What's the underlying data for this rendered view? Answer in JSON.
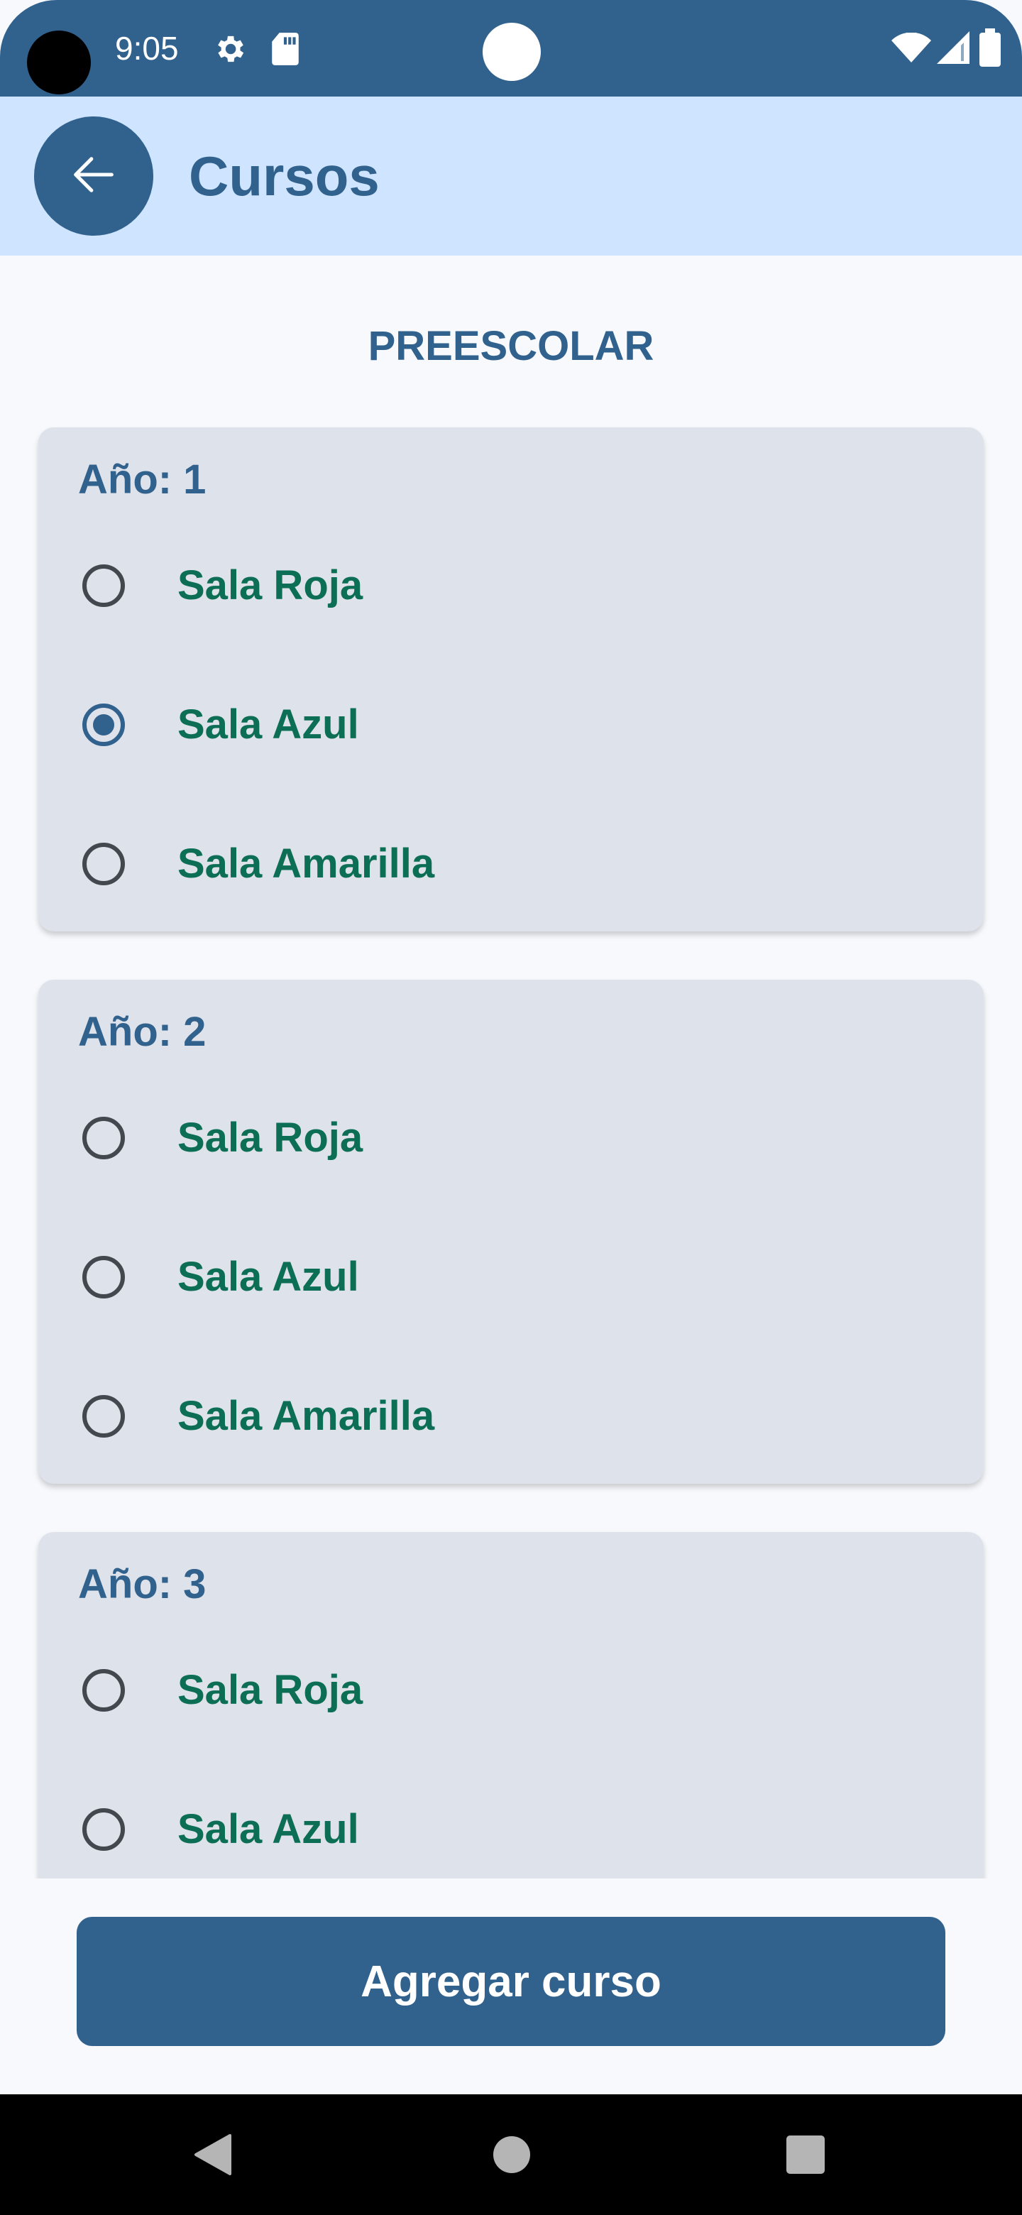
{
  "status_bar": {
    "time": "9:05",
    "icons": [
      "gear-icon",
      "sd-card-icon",
      "wifi-icon",
      "signal-icon",
      "battery-icon"
    ]
  },
  "app_bar": {
    "title": "Cursos",
    "back_icon": "arrow-back-icon"
  },
  "section": {
    "title": "PREESCOLAR"
  },
  "years": [
    {
      "title": "Año: 1",
      "options": [
        {
          "label": "Sala Roja",
          "selected": false
        },
        {
          "label": "Sala Azul",
          "selected": true
        },
        {
          "label": "Sala Amarilla",
          "selected": false
        }
      ]
    },
    {
      "title": "Año: 2",
      "options": [
        {
          "label": "Sala Roja",
          "selected": false
        },
        {
          "label": "Sala Azul",
          "selected": false
        },
        {
          "label": "Sala Amarilla",
          "selected": false
        }
      ]
    },
    {
      "title": "Año: 3",
      "options": [
        {
          "label": "Sala Roja",
          "selected": false
        },
        {
          "label": "Sala Azul",
          "selected": false
        }
      ]
    }
  ],
  "actions": {
    "add_course_label": "Agregar curso"
  },
  "nav_bar": {
    "icons": [
      "back-triangle-icon",
      "home-circle-icon",
      "recents-square-icon"
    ]
  },
  "colors": {
    "primary": "#31618d",
    "app_bar_bg": "#cfe4ff",
    "card_bg": "#dee2ea",
    "option_text": "#0b6e55",
    "page_bg": "#f7f9fd"
  }
}
